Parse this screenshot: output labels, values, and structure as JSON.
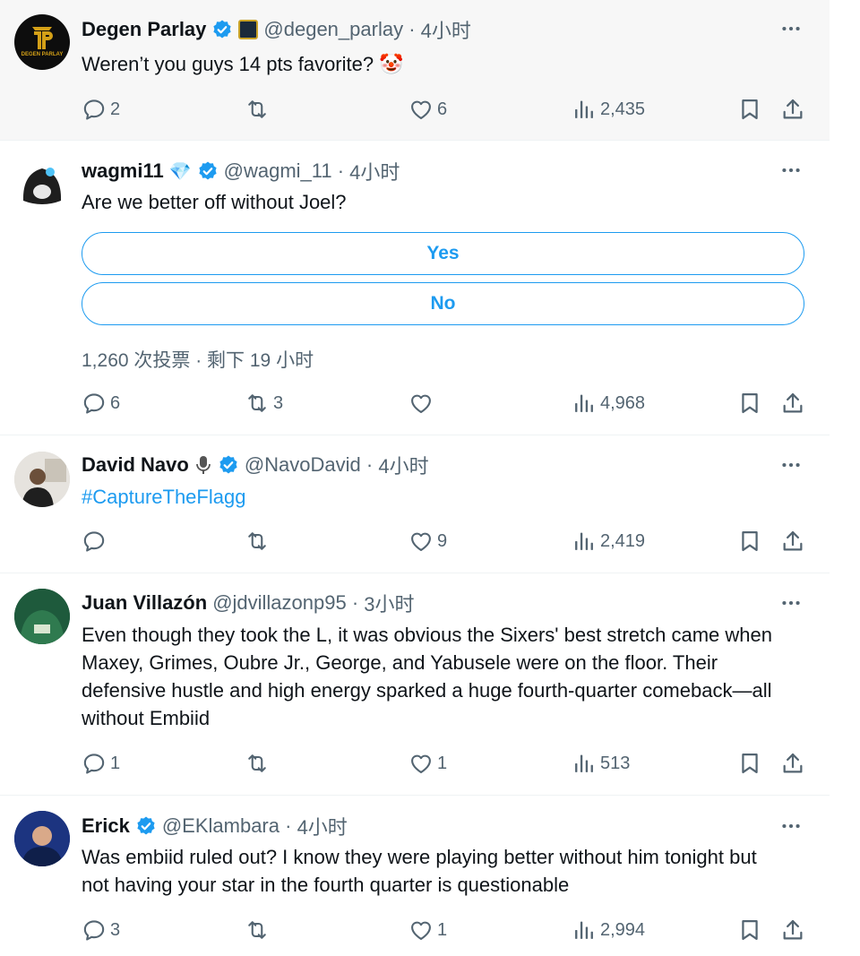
{
  "tweets": [
    {
      "name": "Degen Parlay",
      "handle": "@degen_parlay",
      "time": "4小时",
      "text": "Weren’t you guys 14 pts favorite? 🤡",
      "avatar_text": "DEGEN PARLAY",
      "replies": "2",
      "reposts": "",
      "likes": "6",
      "views": "2,435"
    },
    {
      "name": "wagmi11",
      "handle": "@wagmi_11",
      "time": "4小时",
      "text": "Are we better off without Joel?",
      "poll": {
        "options": [
          "Yes",
          "No"
        ],
        "meta": "1,260 次投票 · 剩下 19 小时"
      },
      "replies": "6",
      "reposts": "3",
      "likes": "",
      "views": "4,968"
    },
    {
      "name": "David Navo",
      "handle": "@NavoDavid",
      "time": "4小时",
      "text": "#CaptureTheFlagg",
      "replies": "",
      "reposts": "",
      "likes": "9",
      "views": "2,419"
    },
    {
      "name": "Juan Villazón",
      "handle": "@jdvillazonp95",
      "time": "3小时",
      "text": "Even though they took the L, it was obvious the Sixers' best stretch came when Maxey, Grimes, Oubre Jr., George, and Yabusele were on the floor. Their defensive hustle and high energy sparked a huge fourth-quarter comeback—all without Embiid",
      "replies": "1",
      "reposts": "",
      "likes": "1",
      "views": "513"
    },
    {
      "name": "Erick",
      "handle": "@EKlambara",
      "time": "4小时",
      "text": "Was embiid ruled out? I know they were playing better without him tonight but not having your star in the fourth quarter is questionable",
      "replies": "3",
      "reposts": "",
      "likes": "1",
      "views": "2,994"
    }
  ],
  "colors": {
    "accent": "#1d9bf0",
    "muted": "#536471",
    "text": "#0f1419",
    "highlight_bg": "#f7f7f7"
  }
}
